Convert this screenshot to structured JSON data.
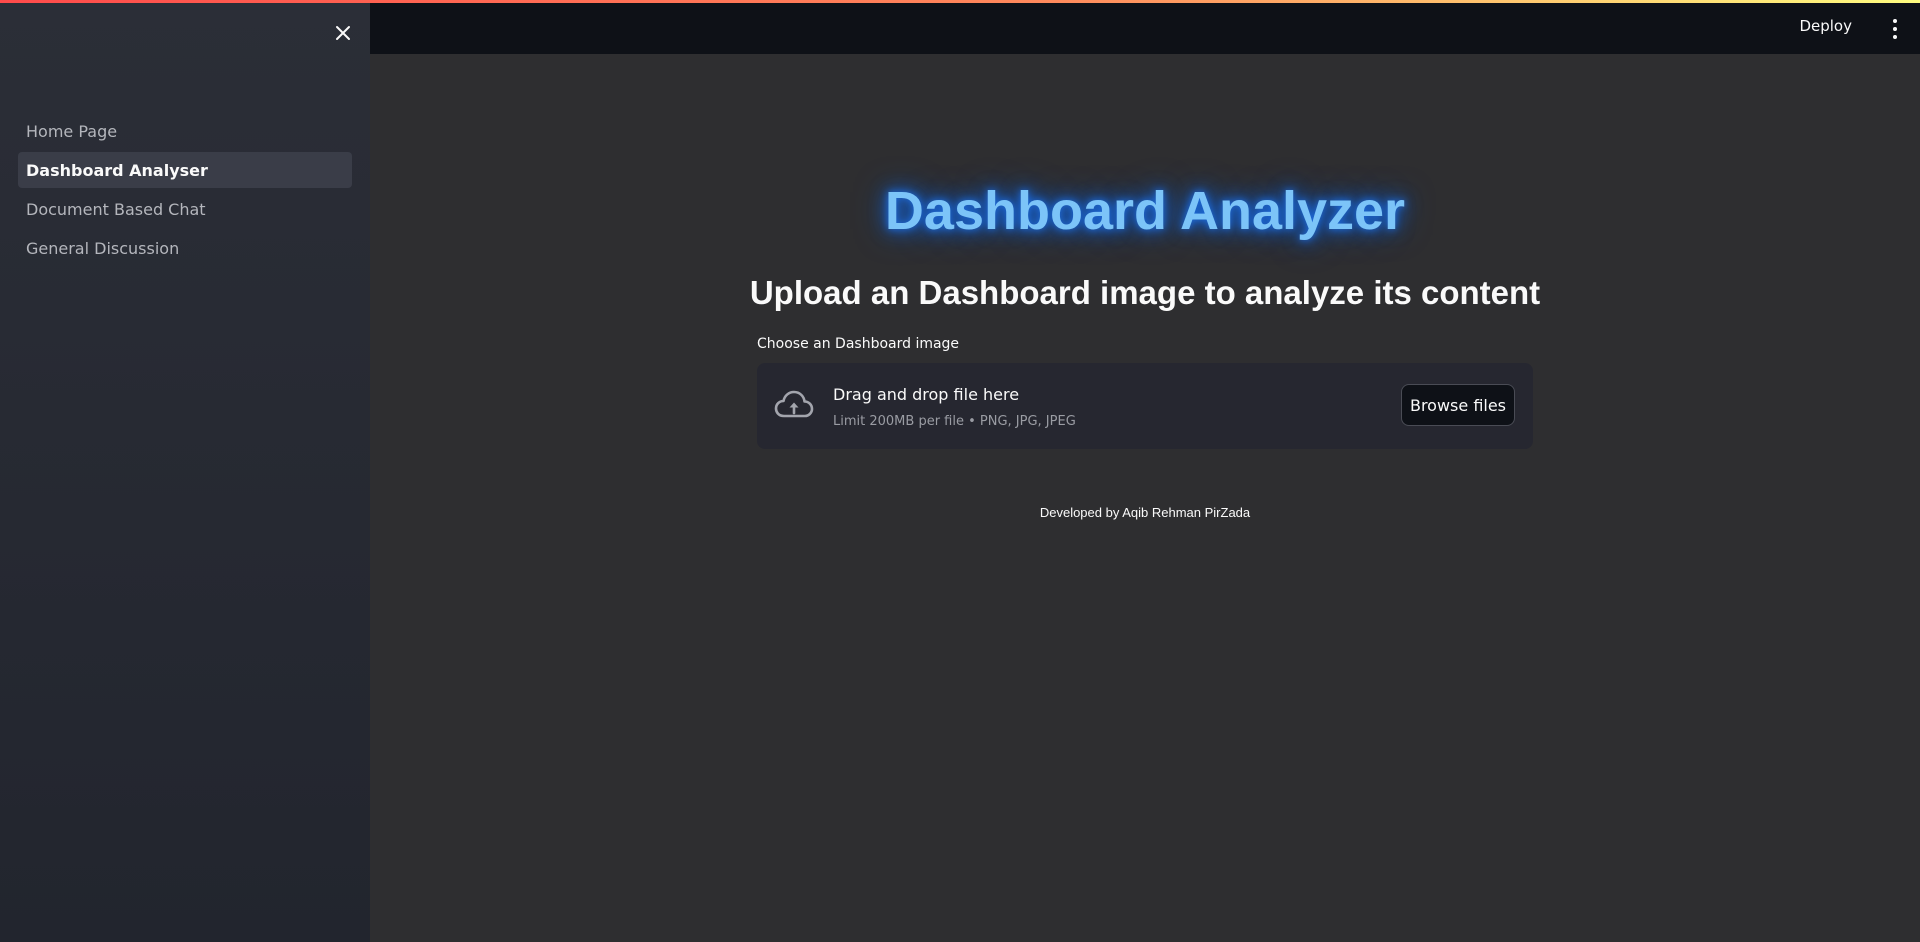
{
  "sidebar": {
    "close_icon": "close-icon",
    "items": [
      {
        "label": "Home Page",
        "active": false
      },
      {
        "label": "Dashboard Analyser",
        "active": true
      },
      {
        "label": "Document Based Chat",
        "active": false
      },
      {
        "label": "General Discussion",
        "active": false
      }
    ]
  },
  "header": {
    "deploy_label": "Deploy",
    "menu_icon": "kebab-menu-icon"
  },
  "main": {
    "title": "Dashboard Analyzer",
    "subtitle": "Upload an Dashboard image to analyze its content",
    "uploader": {
      "label": "Choose an Dashboard image",
      "drop_text": "Drag and drop file here",
      "limit_text": "Limit 200MB per file • PNG, JPG, JPEG",
      "browse_label": "Browse files",
      "icon": "cloud-upload-icon"
    },
    "footer": "Developed by Aqib Rehman PirZada"
  },
  "colors": {
    "accent_stripe_start": "#ff4b4b",
    "accent_stripe_end": "#fffd80",
    "title_glow": "#1e6fe6",
    "title_text": "#7cc4f8"
  }
}
